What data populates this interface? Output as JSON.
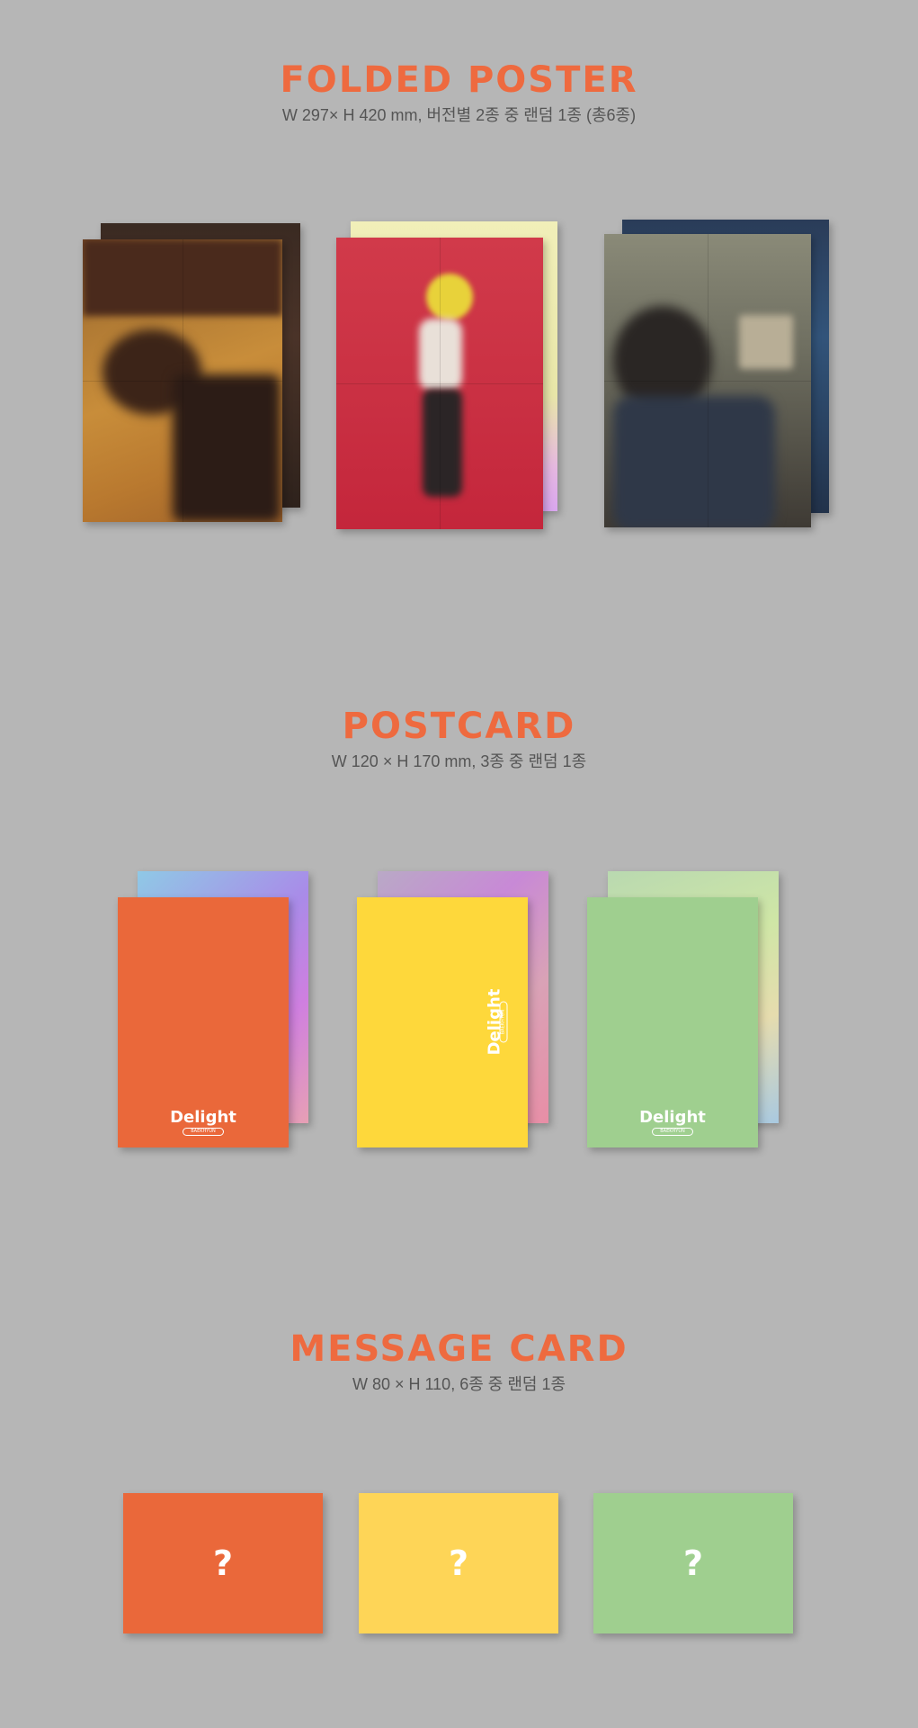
{
  "folded_poster": {
    "title": "FOLDED POSTER",
    "subtitle": "W 297× H 420 mm, 버전별 2종 중 랜덤 1종 (총6종)"
  },
  "postcard": {
    "title": "POSTCARD",
    "subtitle": "W 120 × H 170 mm, 3종 중 랜덤 1종",
    "cards": [
      {
        "text": "Delight",
        "sub": "BAEKHYUN",
        "color": "#ea683a"
      },
      {
        "text": "Delight",
        "sub": "BAEKHYUN",
        "color": "#fed83b"
      },
      {
        "text": "Delight",
        "sub": "BAEKHYUN",
        "color": "#9fcf8f"
      }
    ]
  },
  "message_card": {
    "title": "MESSAGE CARD",
    "subtitle": "W 80 × H 110, 6종 중 랜덤 1종",
    "cards": [
      {
        "symbol": "?",
        "color": "#ea683a"
      },
      {
        "symbol": "?",
        "color": "#fed557"
      },
      {
        "symbol": "?",
        "color": "#9fcf8f"
      }
    ]
  },
  "colors": {
    "background": "#b6b6b6",
    "title_accent": "#ee6a3f"
  }
}
